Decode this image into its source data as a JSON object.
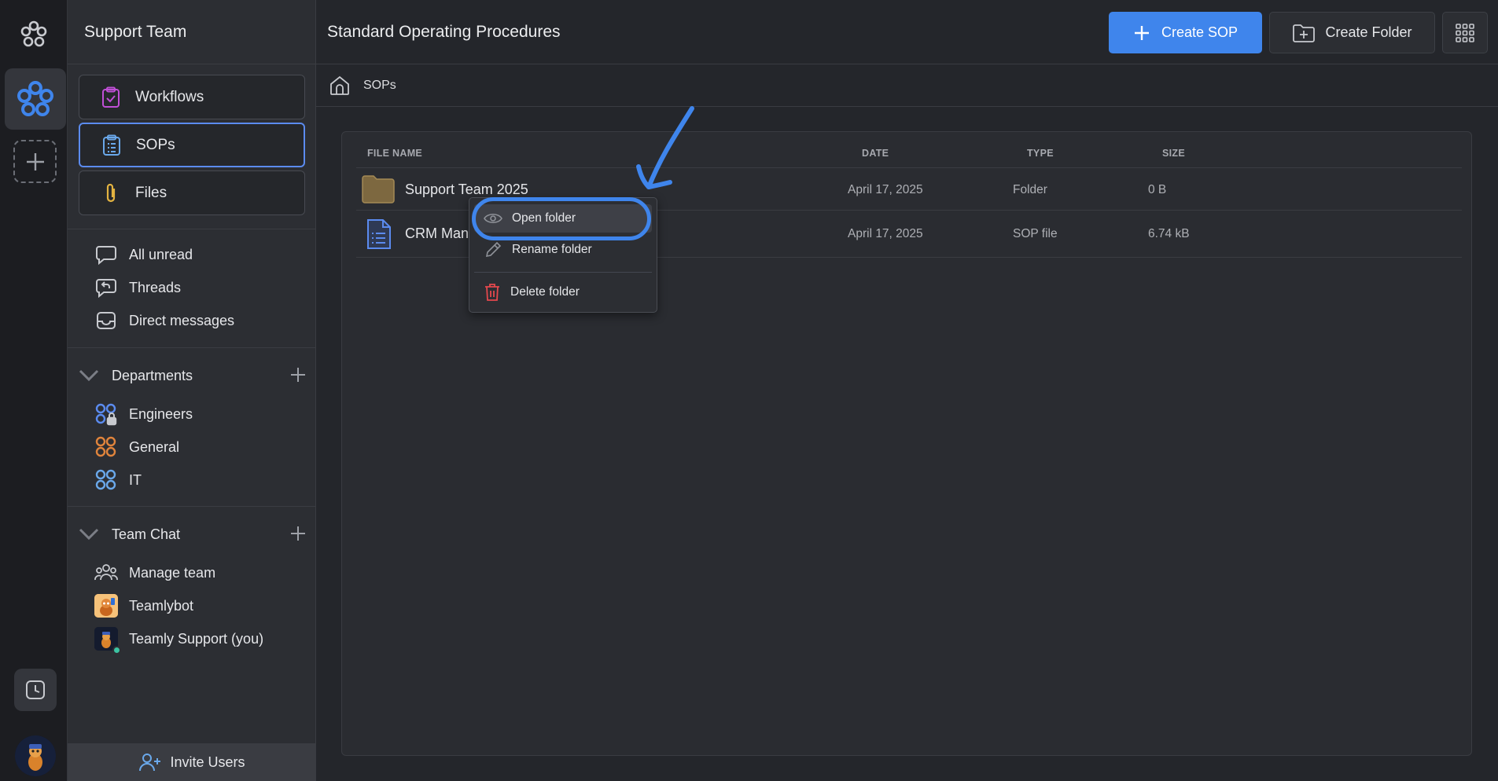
{
  "sidebar": {
    "team_name": "Support Team",
    "nav": [
      {
        "label": "Workflows",
        "icon": "clipboard-check-icon"
      },
      {
        "label": "SOPs",
        "icon": "list-doc-icon",
        "active": true
      },
      {
        "label": "Files",
        "icon": "paperclip-icon"
      }
    ],
    "messages": [
      {
        "label": "All unread",
        "icon": "chat-bubble-icon"
      },
      {
        "label": "Threads",
        "icon": "reply-bubble-icon"
      },
      {
        "label": "Direct messages",
        "icon": "inbox-icon"
      }
    ],
    "departments": {
      "title": "Departments",
      "items": [
        {
          "label": "Engineers",
          "icon": "group-lock-icon"
        },
        {
          "label": "General",
          "icon": "group-icon"
        },
        {
          "label": "IT",
          "icon": "group-icon"
        }
      ]
    },
    "team_chat": {
      "title": "Team Chat",
      "items": [
        {
          "label": "Manage team",
          "icon": "people-icon"
        },
        {
          "label": "Teamlybot",
          "icon": "bot-avatar"
        },
        {
          "label": "Teamly Support (you)",
          "icon": "user-avatar"
        }
      ]
    },
    "invite_label": "Invite Users"
  },
  "header": {
    "title": "Standard Operating Procedures",
    "create_sop_label": "Create SOP",
    "create_folder_label": "Create Folder"
  },
  "breadcrumb": {
    "current": "SOPs"
  },
  "table": {
    "columns": [
      "FILE NAME",
      "DATE",
      "TYPE",
      "SIZE"
    ],
    "rows": [
      {
        "name": "Support Team 2025",
        "date": "April 17, 2025",
        "type": "Folder",
        "size": "0 B",
        "icon": "folder-icon"
      },
      {
        "name": "CRM Man",
        "date": "April 17, 2025",
        "type": "SOP file",
        "size": "6.74 kB",
        "icon": "document-icon"
      }
    ]
  },
  "context_menu": {
    "items": [
      {
        "label": "Open folder",
        "icon": "eye-icon"
      },
      {
        "label": "Rename folder",
        "icon": "pencil-icon"
      },
      {
        "label": "Delete folder",
        "icon": "trash-icon"
      }
    ]
  },
  "colors": {
    "accent": "#3f85ec",
    "sidebar_bg": "#2c2e33",
    "main_bg": "#24262b",
    "rail_bg": "#1c1d21",
    "danger": "#e5484d"
  }
}
